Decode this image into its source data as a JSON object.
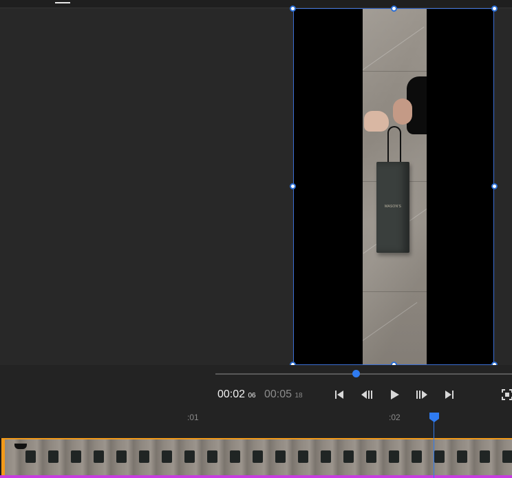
{
  "playback": {
    "current_time": "00:02",
    "current_frames": "06",
    "total_time": "00:05",
    "total_frames": "18",
    "progress_fraction": 0.47
  },
  "controls": {
    "go_to_start": "skip-back-icon",
    "previous_frame": "step-back-icon",
    "play": "play-icon",
    "next_frame": "step-forward-icon",
    "go_to_end": "skip-forward-icon",
    "fullscreen": "fullscreen-icon"
  },
  "ruler": {
    "labels": [
      ":01",
      ":02"
    ]
  },
  "preview": {
    "bag_logo_text": "MASON'S"
  },
  "colors": {
    "accent": "#2f7bf0",
    "clip_border": "#f29a1a",
    "clip_bottom": "#c83be0"
  }
}
